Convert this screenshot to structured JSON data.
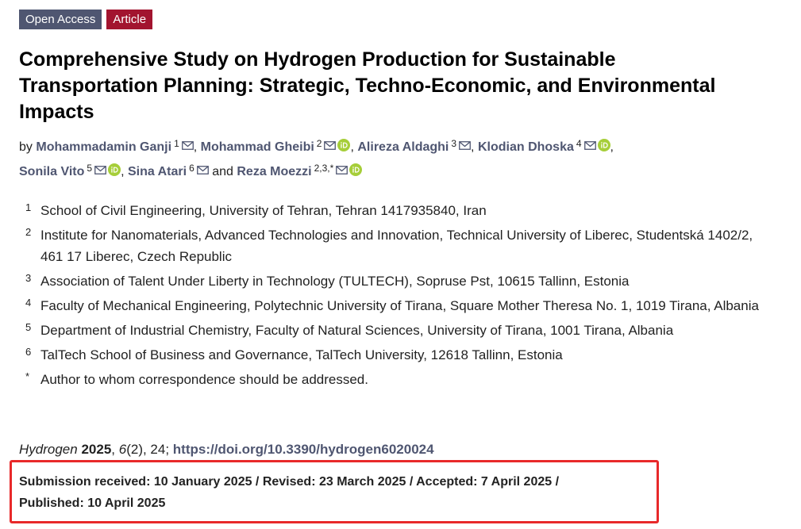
{
  "badges": {
    "open_access": "Open Access",
    "article": "Article"
  },
  "title": "Comprehensive Study on Hydrogen Production for Sustainable Transportation Planning: Strategic, Techno-Economic, and Environmental Impacts",
  "authors": {
    "by": "by",
    "list": [
      {
        "name": "Mohammadamin Ganji",
        "aff": "1",
        "orcid": false,
        "sep": ","
      },
      {
        "name": "Mohammad Gheibi",
        "aff": "2",
        "orcid": true,
        "sep": ","
      },
      {
        "name": "Alireza Aldaghi",
        "aff": "3",
        "orcid": false,
        "sep": ","
      },
      {
        "name": "Klodian Dhoska",
        "aff": "4",
        "orcid": true,
        "sep": ","
      },
      {
        "name": "Sonila Vito",
        "aff": "5",
        "orcid": true,
        "sep": ","
      },
      {
        "name": "Sina Atari",
        "aff": "6",
        "orcid": false,
        "sep": "and"
      },
      {
        "name": "Reza Moezzi",
        "aff": "2,3,*",
        "orcid": true,
        "sep": ""
      }
    ]
  },
  "affiliations": [
    {
      "num": "1",
      "text": "School of Civil Engineering, University of Tehran, Tehran 1417935840, Iran"
    },
    {
      "num": "2",
      "text": "Institute for Nanomaterials, Advanced Technologies and Innovation, Technical University of Liberec, Studentská 1402/2, 461 17 Liberec, Czech Republic"
    },
    {
      "num": "3",
      "text": "Association of Talent Under Liberty in Technology (TULTECH), Sopruse Pst, 10615 Tallinn, Estonia"
    },
    {
      "num": "4",
      "text": "Faculty of Mechanical Engineering, Polytechnic University of Tirana, Square Mother Theresa No. 1, 1019 Tirana, Albania"
    },
    {
      "num": "5",
      "text": "Department of Industrial Chemistry, Faculty of Natural Sciences, University of Tirana, 1001 Tirana, Albania"
    },
    {
      "num": "6",
      "text": "TalTech School of Business and Governance, TalTech University, 12618 Tallinn, Estonia"
    },
    {
      "num": "*",
      "text": "Author to whom correspondence should be addressed."
    }
  ],
  "citation": {
    "journal": "Hydrogen",
    "year": "2025",
    "volume": "6",
    "issue_pages": "(2), 24;",
    "doi": "https://doi.org/10.3390/hydrogen6020024"
  },
  "dates": {
    "line1": "Submission received: 10 January 2025 / Revised: 23 March 2025 / Accepted: 7 April 2025 /",
    "line2": "Published: 10 April 2025"
  },
  "colors": {
    "link": "#4f5671",
    "open_access_bg": "#4f5671",
    "article_bg": "#a2142f",
    "orcid": "#a6ce39",
    "highlight_box": "#e8292a"
  },
  "icons": {
    "mail": "mail-icon",
    "orcid": "orcid-icon"
  }
}
